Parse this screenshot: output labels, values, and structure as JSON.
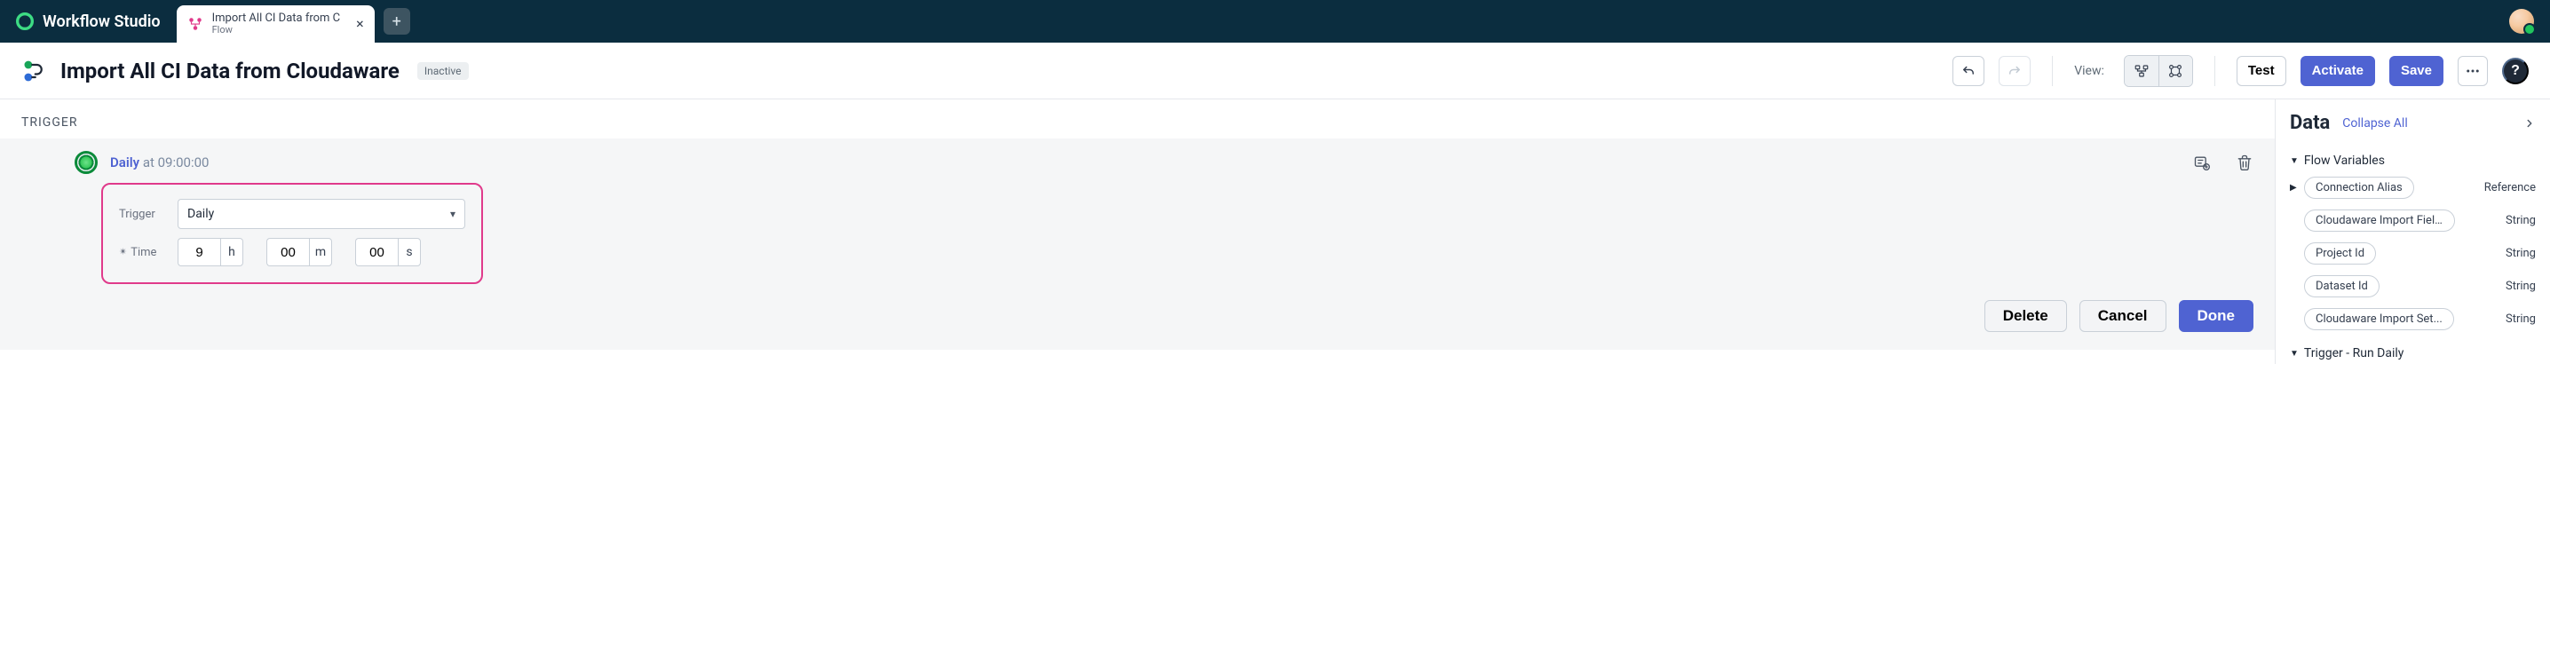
{
  "brand": {
    "name": "Workflow Studio"
  },
  "tab": {
    "title": "Import All CI Data from C",
    "subtitle": "Flow"
  },
  "header": {
    "title": "Import All CI Data from Cloudaware",
    "status": "Inactive",
    "view_label": "View:",
    "test_label": "Test",
    "activate_label": "Activate",
    "save_label": "Save"
  },
  "canvas": {
    "section_label": "TRIGGER",
    "node": {
      "name": "Daily",
      "suffix": "at 09:00:00"
    },
    "trigger_form": {
      "trigger_label": "Trigger",
      "trigger_value": "Daily",
      "time_label": "Time",
      "h_value": "9",
      "h_unit": "h",
      "m_value": "00",
      "m_unit": "m",
      "s_value": "00",
      "s_unit": "s"
    },
    "actions": {
      "delete": "Delete",
      "cancel": "Cancel",
      "done": "Done"
    }
  },
  "data_panel": {
    "title": "Data",
    "collapse": "Collapse All",
    "sections": [
      {
        "title": "Flow Variables",
        "expanded": true
      },
      {
        "title": "Trigger - Run Daily",
        "expanded": true
      }
    ],
    "vars": [
      {
        "name": "Connection Alias",
        "type": "Reference",
        "expandable": true
      },
      {
        "name": "Cloudaware Import Fiel...",
        "type": "String",
        "expandable": false
      },
      {
        "name": "Project Id",
        "type": "String",
        "expandable": false
      },
      {
        "name": "Dataset Id",
        "type": "String",
        "expandable": false
      },
      {
        "name": "Cloudaware Import Set...",
        "type": "String",
        "expandable": false
      }
    ]
  }
}
